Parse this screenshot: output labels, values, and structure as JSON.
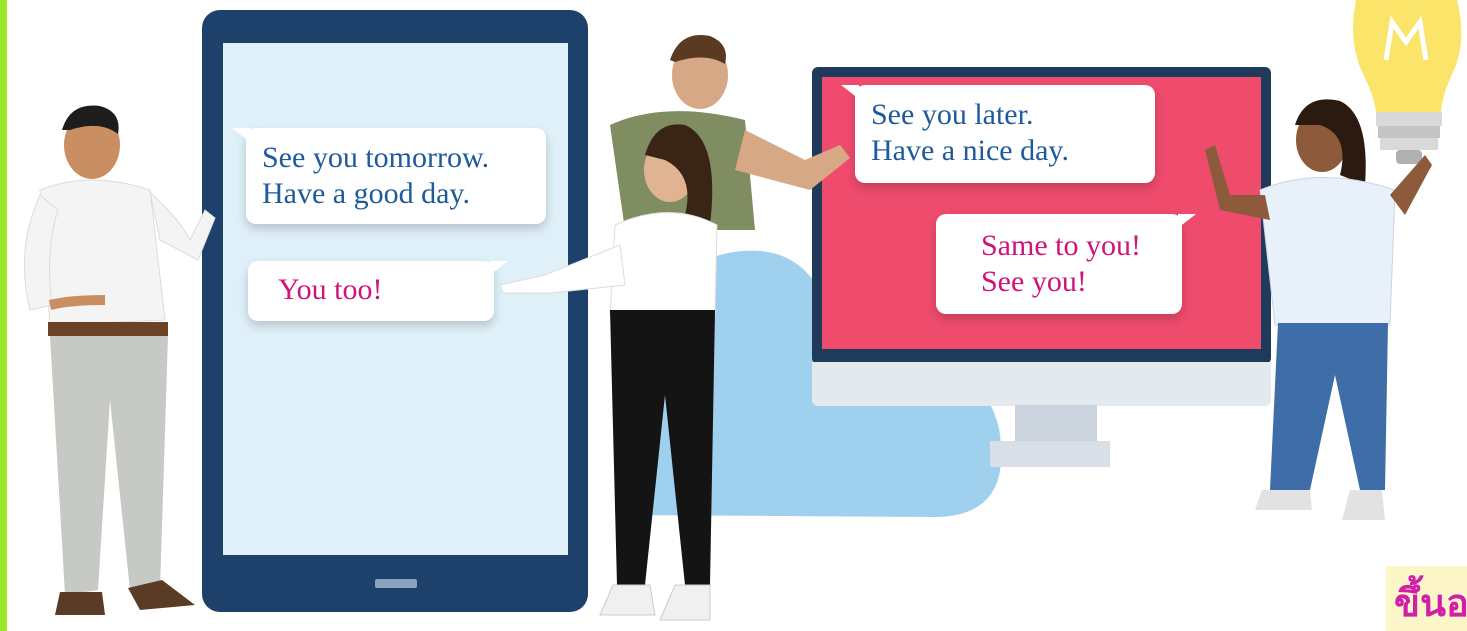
{
  "tablet_chat": {
    "message_1": {
      "line_1": "See you tomorrow.",
      "line_2": "Have a good day."
    },
    "message_2": {
      "line_1": "You too!"
    }
  },
  "monitor_chat": {
    "message_1": {
      "line_1": "See you later.",
      "line_2": "Have a nice day."
    },
    "message_2": {
      "line_1": "Same to you!",
      "line_2": "See you!"
    }
  },
  "corner_label": "ขึ้นอ",
  "colors": {
    "accent_green": "#9be52a",
    "tablet_frame": "#1d416b",
    "tablet_screen": "#dff0f9",
    "monitor_screen": "#ef4b6d",
    "cloud": "#9fd0ee",
    "text_blue": "#1e5a9c",
    "text_pink": "#d0137a",
    "bulb_yellow": "#fbe46a",
    "label_magenta": "#d01fa8"
  },
  "icons": [
    "cloud-icon",
    "light-bulb-icon",
    "tablet-icon",
    "monitor-icon"
  ]
}
